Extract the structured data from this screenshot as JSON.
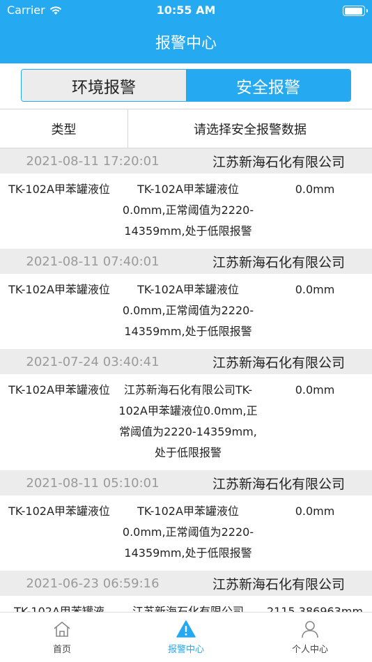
{
  "status_bar": {
    "carrier": "Carrier",
    "time": "10:55 AM",
    "battery_level": 0.95
  },
  "header": {
    "title": "报警中心"
  },
  "segments": {
    "environment": "环境报警",
    "safety": "安全报警",
    "active": "safety"
  },
  "filter": {
    "type_label": "类型",
    "select_label": "请选择安全报警数据"
  },
  "alarms": [
    {
      "time": "2021-08-11 17:20:01",
      "company": "江苏新海石化有限公司",
      "name": "TK-102A甲苯罐液位",
      "desc": "TK-102A甲苯罐液位0.0mm,正常阈值为2220-14359mm,处于低限报警",
      "value": "0.0mm"
    },
    {
      "time": "2021-08-11 07:40:01",
      "company": "江苏新海石化有限公司",
      "name": "TK-102A甲苯罐液位",
      "desc": "TK-102A甲苯罐液位0.0mm,正常阈值为2220-14359mm,处于低限报警",
      "value": "0.0mm"
    },
    {
      "time": "2021-07-24 03:40:41",
      "company": "江苏新海石化有限公司",
      "name": "TK-102A甲苯罐液位",
      "desc": "江苏新海石化有限公司TK-102A甲苯罐液位0.0mm,正常阈值为2220-14359mm,处于低限报警",
      "value": "0.0mm"
    },
    {
      "time": "2021-08-11 05:10:01",
      "company": "江苏新海石化有限公司",
      "name": "TK-102A甲苯罐液位",
      "desc": "TK-102A甲苯罐液位0.0mm,正常阈值为2220-14359mm,处于低限报警",
      "value": "0.0mm"
    },
    {
      "time": "2021-06-23 06:59:16",
      "company": "江苏新海石化有限公司",
      "name": "TK-102A甲苯罐液",
      "desc": "江苏新海石化有限公司",
      "value": "2115.386963mm"
    }
  ],
  "tabbar": {
    "home": "首页",
    "alarm": "报警中心",
    "profile": "个人中心",
    "active": "alarm"
  },
  "colors": {
    "accent": "#25a9f0",
    "row_header_bg": "#ececec",
    "time_text": "#9a9a9a"
  }
}
